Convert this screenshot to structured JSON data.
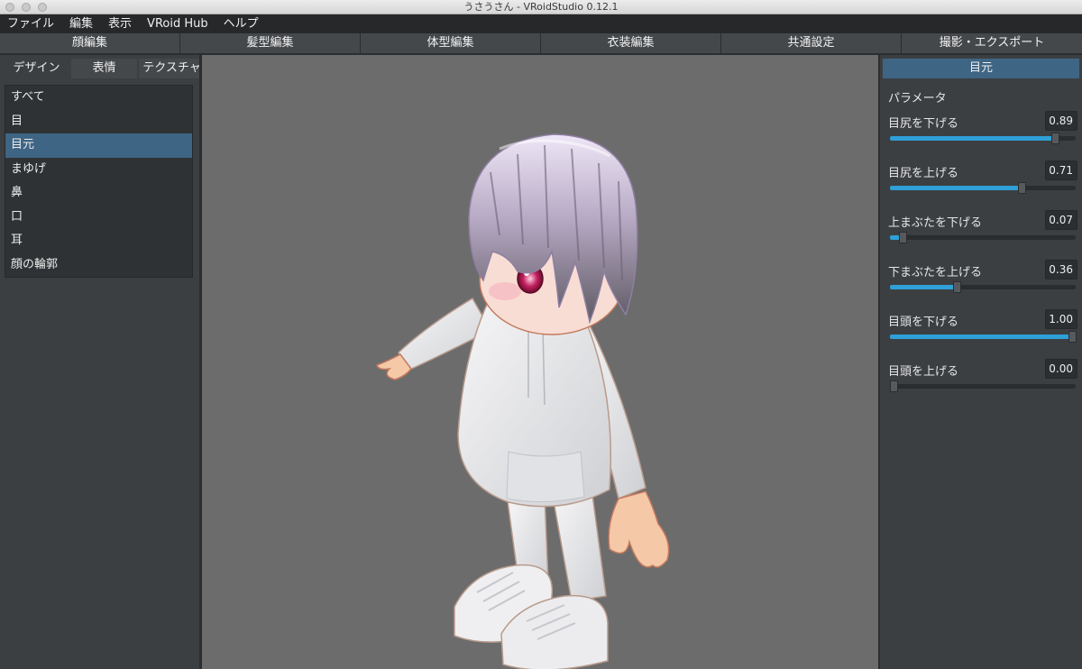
{
  "window": {
    "title": "うさうさん - VRoidStudio 0.12.1"
  },
  "menu": [
    "ファイル",
    "編集",
    "表示",
    "VRoid Hub",
    "ヘルプ"
  ],
  "top_tabs": [
    "顔編集",
    "髪型編集",
    "体型編集",
    "衣装編集",
    "共通設定",
    "撮影・エクスポート"
  ],
  "left": {
    "sub_tabs": [
      "デザイン",
      "表情",
      "テクスチャ"
    ],
    "categories": [
      "すべて",
      "目",
      "目元",
      "まゆげ",
      "鼻",
      "口",
      "耳",
      "顔の輪郭"
    ],
    "selected_category": "目元"
  },
  "right": {
    "header": "目元",
    "section": "パラメータ",
    "params": [
      {
        "label": "目尻を下げる",
        "value": "0.89",
        "level": 0.89
      },
      {
        "label": "目尻を上げる",
        "value": "0.71",
        "level": 0.71
      },
      {
        "label": "上まぶたを下げる",
        "value": "0.07",
        "level": 0.07
      },
      {
        "label": "下まぶたを上げる",
        "value": "0.36",
        "level": 0.36
      },
      {
        "label": "目頭を下げる",
        "value": "1.00",
        "level": 1.0
      },
      {
        "label": "目頭を上げる",
        "value": "0.00",
        "level": 0.0
      }
    ]
  },
  "colors": {
    "accent": "#2f9fd8",
    "selection": "#3f6585",
    "viewport_bg": "#6c6c6c"
  },
  "icons": {
    "viewport_model": "3d-avatar-model"
  }
}
